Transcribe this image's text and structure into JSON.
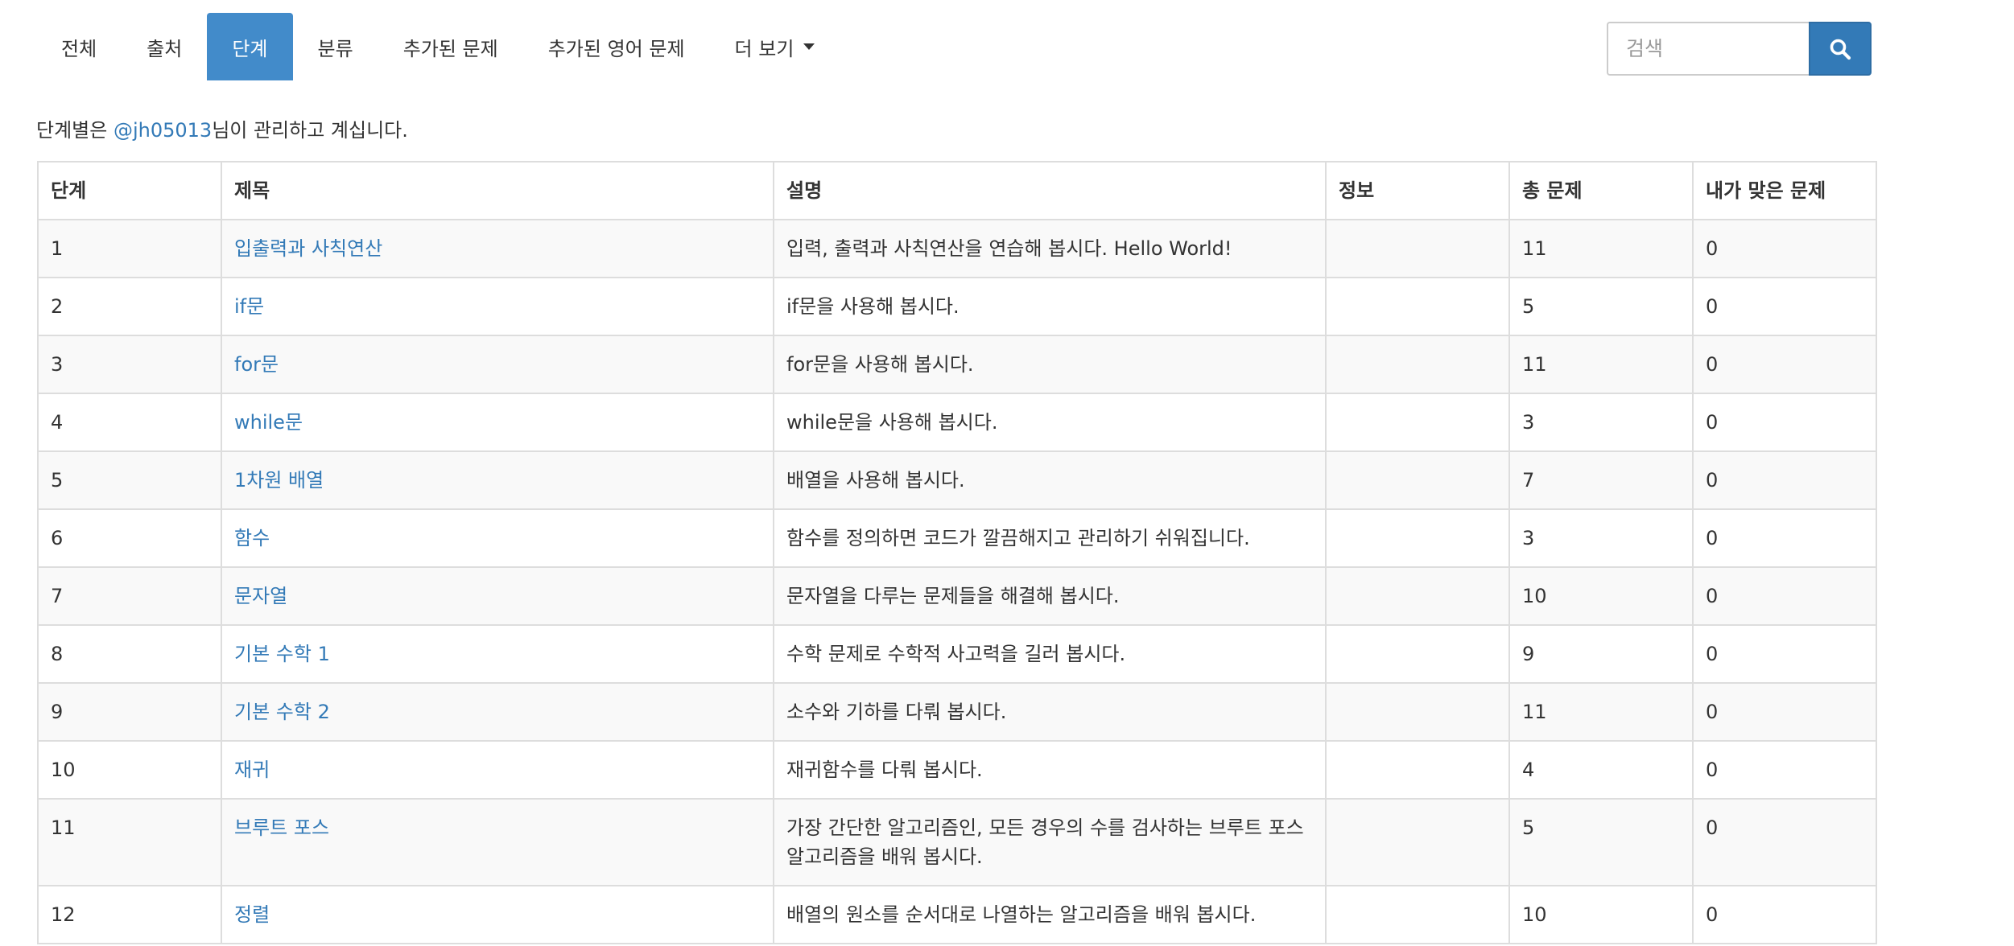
{
  "nav": {
    "items": [
      {
        "label": "전체"
      },
      {
        "label": "출처"
      },
      {
        "label": "단계"
      },
      {
        "label": "분류"
      },
      {
        "label": "추가된 문제"
      },
      {
        "label": "추가된 영어 문제"
      },
      {
        "label": "더 보기"
      }
    ],
    "active_index": 2
  },
  "search": {
    "placeholder": "검색",
    "icon": "search-icon"
  },
  "info": {
    "prefix": "단계별은 ",
    "user": "@jh05013",
    "suffix": "님이 관리하고 계십니다."
  },
  "table": {
    "headers": [
      "단계",
      "제목",
      "설명",
      "정보",
      "총 문제",
      "내가 맞은 문제"
    ],
    "rows": [
      {
        "step": "1",
        "title": "입출력과 사칙연산",
        "desc": "입력, 출력과 사칙연산을 연습해 봅시다. Hello World!",
        "info": "",
        "total": "11",
        "solved": "0"
      },
      {
        "step": "2",
        "title": "if문",
        "desc": "if문을 사용해 봅시다.",
        "info": "",
        "total": "5",
        "solved": "0"
      },
      {
        "step": "3",
        "title": "for문",
        "desc": "for문을 사용해 봅시다.",
        "info": "",
        "total": "11",
        "solved": "0"
      },
      {
        "step": "4",
        "title": "while문",
        "desc": "while문을 사용해 봅시다.",
        "info": "",
        "total": "3",
        "solved": "0"
      },
      {
        "step": "5",
        "title": "1차원 배열",
        "desc": "배열을 사용해 봅시다.",
        "info": "",
        "total": "7",
        "solved": "0"
      },
      {
        "step": "6",
        "title": "함수",
        "desc": "함수를 정의하면 코드가 깔끔해지고 관리하기 쉬워집니다.",
        "info": "",
        "total": "3",
        "solved": "0"
      },
      {
        "step": "7",
        "title": "문자열",
        "desc": "문자열을 다루는 문제들을 해결해 봅시다.",
        "info": "",
        "total": "10",
        "solved": "0"
      },
      {
        "step": "8",
        "title": "기본 수학 1",
        "desc": "수학 문제로 수학적 사고력을 길러 봅시다.",
        "info": "",
        "total": "9",
        "solved": "0"
      },
      {
        "step": "9",
        "title": "기본 수학 2",
        "desc": "소수와 기하를 다뤄 봅시다.",
        "info": "",
        "total": "11",
        "solved": "0"
      },
      {
        "step": "10",
        "title": "재귀",
        "desc": "재귀함수를 다뤄 봅시다.",
        "info": "",
        "total": "4",
        "solved": "0"
      },
      {
        "step": "11",
        "title": "브루트 포스",
        "desc": "가장 간단한 알고리즘인, 모든 경우의 수를 검사하는 브루트 포스 알고리즘을 배워 봅시다.",
        "info": "",
        "total": "5",
        "solved": "0"
      },
      {
        "step": "12",
        "title": "정렬",
        "desc": "배열의 원소를 순서대로 나열하는 알고리즘을 배워 봅시다.",
        "info": "",
        "total": "10",
        "solved": "0"
      }
    ]
  },
  "colors": {
    "accent": "#428bca",
    "link": "#337ab7",
    "search_button": "#337ab7"
  }
}
